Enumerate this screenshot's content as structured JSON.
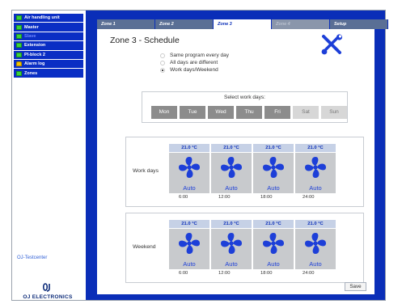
{
  "sidebar": {
    "items": [
      {
        "label": "Air handling unit",
        "dim": false
      },
      {
        "label": "Master",
        "dim": false
      },
      {
        "label": "Slave",
        "dim": true
      },
      {
        "label": "Extension",
        "dim": false
      },
      {
        "label": "PI-block 2",
        "dim": false
      },
      {
        "label": "Alarm log",
        "dim": false
      },
      {
        "label": "Zones",
        "dim": false
      }
    ],
    "user_link": "OJ-Testcenter",
    "logo_text": "OJ ELECTRONICS"
  },
  "tabs": [
    {
      "label": "Zone 1",
      "state": "normal"
    },
    {
      "label": "Zone 2",
      "state": "normal"
    },
    {
      "label": "Zone 3",
      "state": "active"
    },
    {
      "label": "Zone 4",
      "state": "disabled"
    },
    {
      "label": "Setup",
      "state": "normal"
    }
  ],
  "page": {
    "title": "Zone 3 - Schedule",
    "radios": [
      {
        "label": "Same program every day",
        "checked": false
      },
      {
        "label": "All days are different",
        "checked": false
      },
      {
        "label": "Work days/Weekend",
        "checked": true
      }
    ],
    "workdays_label": "Select work days:",
    "days": [
      {
        "label": "Mon",
        "selected": true
      },
      {
        "label": "Tue",
        "selected": true
      },
      {
        "label": "Wed",
        "selected": true
      },
      {
        "label": "Thu",
        "selected": true
      },
      {
        "label": "Fri",
        "selected": true
      },
      {
        "label": "Sat",
        "selected": false
      },
      {
        "label": "Sun",
        "selected": false
      }
    ],
    "schedules": [
      {
        "label": "Work days",
        "slots": [
          {
            "temp": "21.0 °C",
            "mode": "Auto"
          },
          {
            "temp": "21.0 °C",
            "mode": "Auto"
          },
          {
            "temp": "21.0 °C",
            "mode": "Auto"
          },
          {
            "temp": "21.0 °C",
            "mode": "Auto"
          }
        ],
        "times": [
          "6:00",
          "12:00",
          "18:00",
          "24:00"
        ]
      },
      {
        "label": "Weekend",
        "slots": [
          {
            "temp": "21.0 °C",
            "mode": "Auto"
          },
          {
            "temp": "21.0 °C",
            "mode": "Auto"
          },
          {
            "temp": "21.0 °C",
            "mode": "Auto"
          },
          {
            "temp": "21.0 °C",
            "mode": "Auto"
          }
        ],
        "times": [
          "6:00",
          "12:00",
          "18:00",
          "24:00"
        ]
      }
    ],
    "save_label": "Save"
  },
  "colors": {
    "nav_bg": "#0a2ec4",
    "main_bg": "#0a2eb8",
    "fan_blue": "#1d3fd8",
    "tools_blue": "#1d3fd8"
  },
  "icons": {
    "nav_item": "green-folder-icon",
    "tools": "wrench-screwdriver-icon",
    "fan": "fan-icon",
    "logo": "oj-logo-icon"
  }
}
